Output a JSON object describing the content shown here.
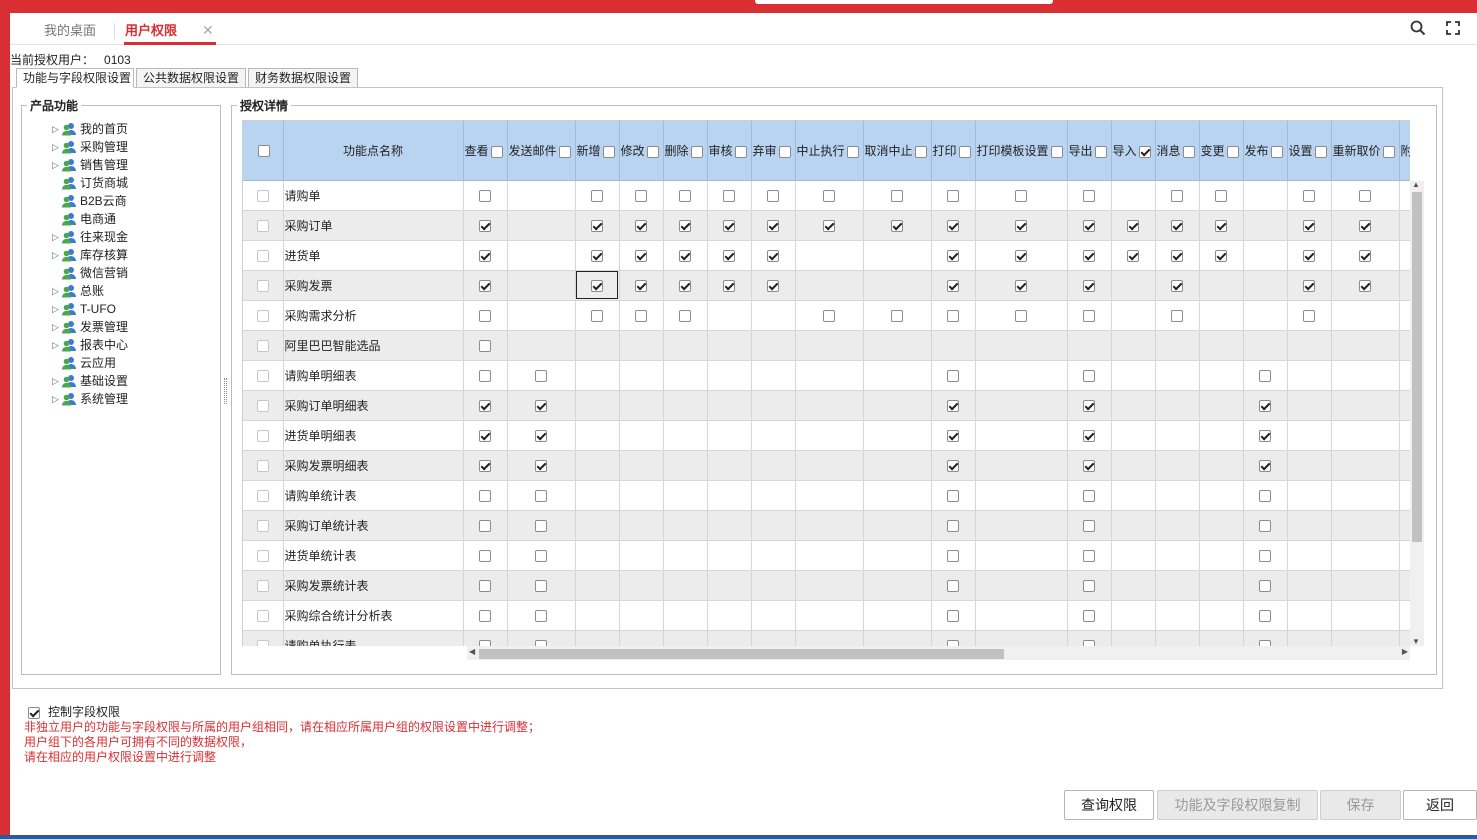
{
  "tabs": {
    "desktop": "我的桌面",
    "user_rights": "用户权限",
    "close": "✕"
  },
  "current_user": {
    "label": "当前授权用户：",
    "value": "0103"
  },
  "subtabs": [
    "功能与字段权限设置",
    "公共数据权限设置",
    "财务数据权限设置"
  ],
  "left_panel": {
    "title": "产品功能",
    "items": [
      {
        "label": "我的首页",
        "expandable": true
      },
      {
        "label": "采购管理",
        "expandable": true
      },
      {
        "label": "销售管理",
        "expandable": true
      },
      {
        "label": "订货商城",
        "expandable": false
      },
      {
        "label": "B2B云商",
        "expandable": false
      },
      {
        "label": "电商通",
        "expandable": false
      },
      {
        "label": "往来现金",
        "expandable": true
      },
      {
        "label": "库存核算",
        "expandable": true
      },
      {
        "label": "微信营销",
        "expandable": false
      },
      {
        "label": "总账",
        "expandable": true
      },
      {
        "label": "T-UFO",
        "expandable": true
      },
      {
        "label": "发票管理",
        "expandable": true
      },
      {
        "label": "报表中心",
        "expandable": true
      },
      {
        "label": "云应用",
        "expandable": false
      },
      {
        "label": "基础设置",
        "expandable": true
      },
      {
        "label": "系统管理",
        "expandable": true
      }
    ]
  },
  "grid": {
    "title": "授权详情",
    "name_header": "功能点名称",
    "columns": [
      "查看",
      "发送邮件",
      "新增",
      "修改",
      "删除",
      "审核",
      "弃审",
      "中止执行",
      "取消中止",
      "打印",
      "打印模板设置",
      "导出",
      "导入",
      "消息",
      "变更",
      "发布",
      "设置",
      "重新取价",
      "附件"
    ],
    "header_checks": [
      0,
      0,
      0,
      0,
      0,
      0,
      0,
      0,
      0,
      0,
      0,
      0,
      1,
      0,
      0,
      0,
      0,
      0,
      0
    ],
    "rows": [
      {
        "name": "请购单",
        "cells": [
          0,
          null,
          0,
          0,
          0,
          0,
          0,
          0,
          0,
          0,
          0,
          0,
          null,
          0,
          0,
          null,
          0,
          0,
          null
        ]
      },
      {
        "name": "采购订单",
        "cells": [
          1,
          null,
          1,
          1,
          1,
          1,
          1,
          1,
          1,
          1,
          1,
          1,
          1,
          1,
          1,
          null,
          1,
          1,
          null
        ]
      },
      {
        "name": "进货单",
        "cells": [
          1,
          null,
          1,
          1,
          1,
          1,
          1,
          null,
          null,
          1,
          1,
          1,
          1,
          1,
          1,
          null,
          1,
          1,
          null
        ]
      },
      {
        "name": "采购发票",
        "cells": [
          1,
          null,
          1,
          1,
          1,
          1,
          1,
          null,
          null,
          1,
          1,
          1,
          null,
          1,
          null,
          null,
          1,
          1,
          null
        ]
      },
      {
        "name": "采购需求分析",
        "cells": [
          0,
          null,
          0,
          0,
          0,
          null,
          null,
          0,
          0,
          0,
          0,
          0,
          null,
          0,
          null,
          null,
          0,
          null,
          null
        ]
      },
      {
        "name": "阿里巴巴智能选品",
        "cells": [
          0,
          null,
          null,
          null,
          null,
          null,
          null,
          null,
          null,
          null,
          null,
          null,
          null,
          null,
          null,
          null,
          null,
          null,
          null
        ]
      },
      {
        "name": "请购单明细表",
        "cells": [
          0,
          0,
          null,
          null,
          null,
          null,
          null,
          null,
          null,
          0,
          null,
          0,
          null,
          null,
          null,
          0,
          null,
          null,
          null
        ]
      },
      {
        "name": "采购订单明细表",
        "cells": [
          1,
          1,
          null,
          null,
          null,
          null,
          null,
          null,
          null,
          1,
          null,
          1,
          null,
          null,
          null,
          1,
          null,
          null,
          null
        ]
      },
      {
        "name": "进货单明细表",
        "cells": [
          1,
          1,
          null,
          null,
          null,
          null,
          null,
          null,
          null,
          1,
          null,
          1,
          null,
          null,
          null,
          1,
          null,
          null,
          null
        ]
      },
      {
        "name": "采购发票明细表",
        "cells": [
          1,
          1,
          null,
          null,
          null,
          null,
          null,
          null,
          null,
          1,
          null,
          1,
          null,
          null,
          null,
          1,
          null,
          null,
          null
        ]
      },
      {
        "name": "请购单统计表",
        "cells": [
          0,
          0,
          null,
          null,
          null,
          null,
          null,
          null,
          null,
          0,
          null,
          0,
          null,
          null,
          null,
          0,
          null,
          null,
          null
        ]
      },
      {
        "name": "采购订单统计表",
        "cells": [
          0,
          0,
          null,
          null,
          null,
          null,
          null,
          null,
          null,
          0,
          null,
          0,
          null,
          null,
          null,
          0,
          null,
          null,
          null
        ]
      },
      {
        "name": "进货单统计表",
        "cells": [
          0,
          0,
          null,
          null,
          null,
          null,
          null,
          null,
          null,
          0,
          null,
          0,
          null,
          null,
          null,
          0,
          null,
          null,
          null
        ]
      },
      {
        "name": "采购发票统计表",
        "cells": [
          0,
          0,
          null,
          null,
          null,
          null,
          null,
          null,
          null,
          0,
          null,
          0,
          null,
          null,
          null,
          0,
          null,
          null,
          null
        ]
      },
      {
        "name": "采购综合统计分析表",
        "cells": [
          0,
          0,
          null,
          null,
          null,
          null,
          null,
          null,
          null,
          0,
          null,
          0,
          null,
          null,
          null,
          0,
          null,
          null,
          null
        ]
      },
      {
        "name": "请购单执行表",
        "cells": [
          0,
          0,
          null,
          null,
          null,
          null,
          null,
          null,
          null,
          0,
          null,
          0,
          null,
          null,
          null,
          0,
          null,
          null,
          null
        ]
      }
    ]
  },
  "control_field": {
    "label": "控制字段权限",
    "checked": true
  },
  "notes": [
    "非独立用户的功能与字段权限与所属的用户组相同，请在相应所属用户组的权限设置中进行调整；",
    "用户组下的各用户可拥有不同的数据权限，",
    "请在相应的用户权限设置中进行调整"
  ],
  "buttons": {
    "query": "查询权限",
    "copy": "功能及字段权限复制",
    "save": "保存",
    "back": "返回"
  }
}
